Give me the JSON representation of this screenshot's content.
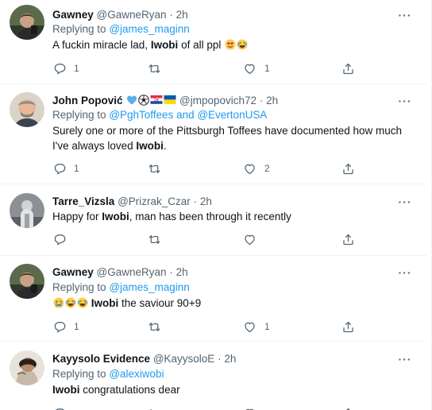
{
  "tweets": [
    {
      "name": "Gawney",
      "handle": "@GawneRyan",
      "dot": "·",
      "time": "2h",
      "replying_prefix": "Replying to",
      "replying_to": "@james_maginn",
      "text_before": "A fuckin miracle lad, ",
      "text_bold": "Iwobi",
      "text_after": " of all ppl",
      "emojis": "heart-eyes-emoji, crying-laughing-emoji",
      "reply_count": "1",
      "retweet_count": "",
      "like_count": "1"
    },
    {
      "name": "John Popović",
      "handle": "@jmpopovich72",
      "dot": "·",
      "time": "2h",
      "replying_prefix": "Replying to",
      "replying_to": "@PghToffees and @EvertonUSA",
      "text_before": "Surely one or more of the Pittsburgh Toffees have documented how much I've always loved ",
      "text_bold": "Iwobi",
      "text_after": ".",
      "emojis": "blue-heart-emoji, soccer-ball-emoji, croatia-flag-emoji, ukraine-flag-emoji",
      "reply_count": "1",
      "retweet_count": "",
      "like_count": "2"
    },
    {
      "name": "Tarre_Vizsla",
      "handle": "@Prizrak_Czar",
      "dot": "·",
      "time": "2h",
      "text_before": "Happy for ",
      "text_bold": "Iwobi",
      "text_after": ", man has been through it recently",
      "reply_count": "",
      "retweet_count": "",
      "like_count": ""
    },
    {
      "name": "Gawney",
      "handle": "@GawneRyan",
      "dot": "·",
      "time": "2h",
      "replying_prefix": "Replying to",
      "replying_to": "@james_maginn",
      "text_before": "",
      "text_bold": "Iwobi",
      "text_after": " the saviour 90+9",
      "emojis": "crying-emoji, crying-laughing-emoji, crying-laughing-emoji",
      "reply_count": "1",
      "retweet_count": "",
      "like_count": "1"
    },
    {
      "name": "Kayysolo Evidence",
      "handle": "@KayysoloE",
      "dot": "·",
      "time": "2h",
      "replying_prefix": "Replying to",
      "replying_to": "@alexiwobi",
      "text_before": "",
      "text_bold": "Iwobi",
      "text_after": " congratulations dear"
    }
  ],
  "more_label": "···",
  "colors": {
    "link": "#1d9bf0",
    "muted": "#536471",
    "text": "#0f1419",
    "divider": "#eff3f4"
  }
}
